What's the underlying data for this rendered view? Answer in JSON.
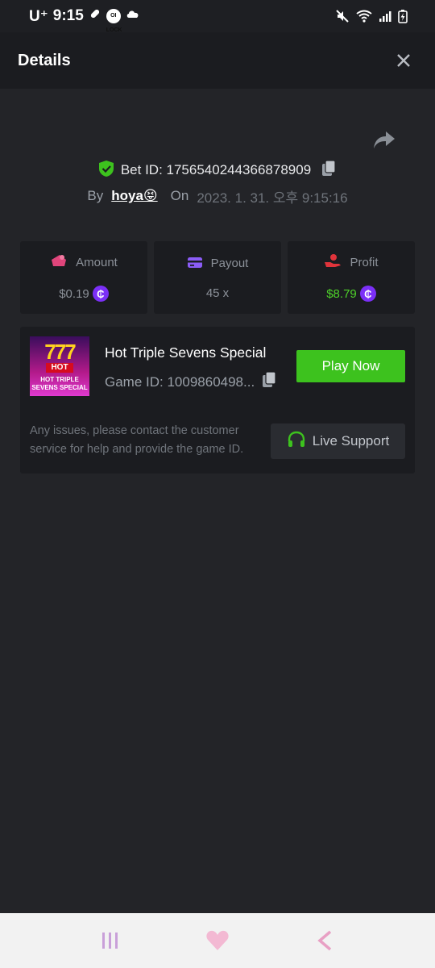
{
  "status_bar": {
    "carrier": "U⁺",
    "time": "9:15",
    "lock_badge": "OI LOCK"
  },
  "header": {
    "title": "Details"
  },
  "bet": {
    "id_label": "Bet ID: 1756540244366878909",
    "by_label": "By",
    "user": "hoya😝",
    "on_label": "On",
    "date": "2023. 1. 31. 오후 9:15:16"
  },
  "stats": {
    "amount": {
      "label": "Amount",
      "value": "$0.19",
      "icon": "wallet-icon",
      "color": "#e0457b"
    },
    "payout": {
      "label": "Payout",
      "value": "45 x",
      "icon": "card-icon",
      "color": "#8b5cf6"
    },
    "profit": {
      "label": "Profit",
      "value": "$8.79",
      "icon": "hand-coin-icon",
      "color": "#e0343b"
    },
    "coin_symbol": "₵"
  },
  "game": {
    "name": "Hot Triple Sevens Special",
    "id_label": "Game ID: 1009860498...",
    "play_label": "Play Now",
    "thumb_sevens": "777",
    "thumb_hot": "HOT",
    "thumb_line1": "HOT TRIPLE",
    "thumb_line2": "SEVENS SPECIAL"
  },
  "support": {
    "text": "Any issues, please contact the customer service for help and provide the game ID.",
    "button_label": "Live Support"
  },
  "colors": {
    "background": "#232428",
    "card": "#1b1c20",
    "accent_green": "#3dc21e",
    "profit_green": "#4ed12a",
    "coin_purple": "#7b2ff7"
  }
}
